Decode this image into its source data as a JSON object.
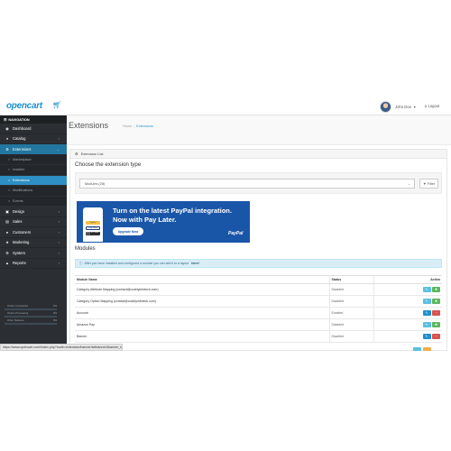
{
  "topbar": {
    "logo": "opencart",
    "logo_cart_icon": "cart-icon",
    "user_name": "John Doe",
    "logout_label": "Logout"
  },
  "sidebar": {
    "header": "NAVIGATION",
    "items": [
      {
        "label": "Dashboard",
        "icon": "dashboard-icon",
        "has_chevron": false
      },
      {
        "label": "Catalog",
        "icon": "tag-icon",
        "has_chevron": true
      },
      {
        "label": "Extensions",
        "icon": "puzzle-icon",
        "has_chevron": true,
        "active": true
      }
    ],
    "subitems": [
      {
        "label": "Marketplace"
      },
      {
        "label": "Installer"
      },
      {
        "label": "Extensions",
        "active": true
      },
      {
        "label": "Modifications"
      },
      {
        "label": "Events"
      }
    ],
    "items_after": [
      {
        "label": "Design",
        "icon": "monitor-icon"
      },
      {
        "label": "Sales",
        "icon": "cart-icon"
      },
      {
        "label": "Customers",
        "icon": "user-icon"
      },
      {
        "label": "Marketing",
        "icon": "share-icon"
      },
      {
        "label": "System",
        "icon": "gear-icon"
      },
      {
        "label": "Reports",
        "icon": "bar-chart-icon"
      }
    ],
    "stats": [
      {
        "label": "Orders Completed",
        "percent": "0%",
        "fill": 0
      },
      {
        "label": "Orders Processing",
        "percent": "0%",
        "fill": 0
      },
      {
        "label": "Other Statuses",
        "percent": "0%",
        "fill": 0
      }
    ]
  },
  "page": {
    "title": "Extensions",
    "breadcrumb": [
      "Home",
      "Extensions"
    ],
    "panel_title": "Extension List",
    "choose_title": "Choose the extension type",
    "select_value": "Modules (28)",
    "filter_label": "Filter"
  },
  "banner": {
    "line1": "Turn on the latest PayPal integration.",
    "line2": "Now with Pay Later.",
    "button": "Upgrade Now",
    "brand": "PayPal",
    "phone_btn1": "PayPal",
    "phone_btn2": "Pay Later",
    "phone_btn3": "Debit or Credit Card"
  },
  "modules": {
    "title": "Modules",
    "alert": "After you have installed and configured a module you can add it to a layout",
    "alert_link": "here!",
    "columns": {
      "name": "Module Name",
      "status": "Status",
      "action": "Action"
    },
    "rows": [
      {
        "name": "Category Attribute Mapping (contact@codelyinfotech.com)",
        "status": "Disabled",
        "installed": true
      },
      {
        "name": "Category Option Mapping (contact@codelyinfotech.com)",
        "status": "Disabled",
        "installed": true
      },
      {
        "name": "Account",
        "status": "Enabled",
        "installed": false
      },
      {
        "name": "Amazon Pay",
        "status": "Disabled",
        "installed": true
      },
      {
        "name": "Banner",
        "status": "Disabled",
        "installed": false
      }
    ]
  },
  "statusbar": {
    "url": "https://www.opencart.com/index.php?route=extension/banner/setbanner&banner_id=6"
  },
  "colors": {
    "accent": "#1e91cf",
    "sidebar_bg": "#2b2f33",
    "active_nav": "#22769f",
    "edit": "#5bc0de",
    "install": "#5cb85c",
    "uninstall": "#d9534f"
  }
}
